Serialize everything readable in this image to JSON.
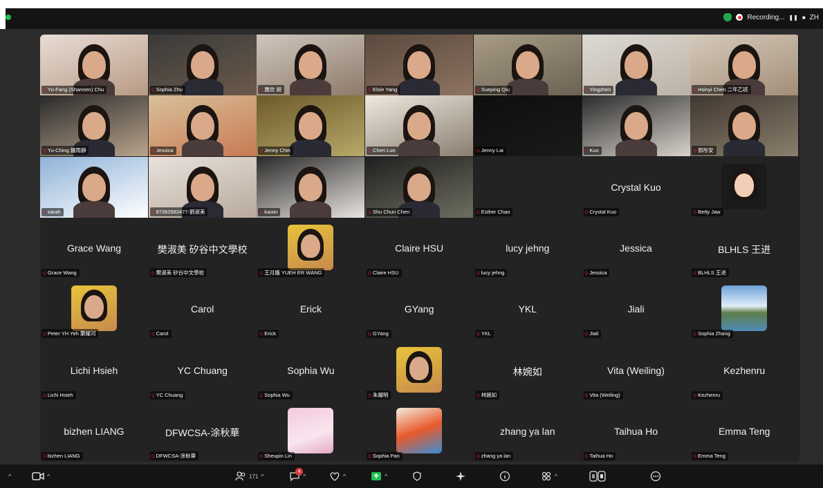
{
  "recording": {
    "label": "Recording...",
    "pause": "❚❚",
    "stop": "■",
    "lang": "ZH"
  },
  "participants": [
    {
      "name": "Yu-Fang (Shannen) Chu",
      "video": true
    },
    {
      "name": "Sophia Zhu",
      "video": true
    },
    {
      "name": "雅欣 胡",
      "video": true
    },
    {
      "name": "Elsie Yang",
      "video": true
    },
    {
      "name": "Sueping Qiu",
      "video": true
    },
    {
      "name": "Yingzhen",
      "video": true
    },
    {
      "name": "Hsinyi Chen 二年乙班",
      "video": true
    },
    {
      "name": "Yu-Ching 鍾雨靜",
      "video": true
    },
    {
      "name": "Jessica",
      "video": true
    },
    {
      "name": "Jenny Chin",
      "video": true
    },
    {
      "name": "Cheri Luo",
      "video": true
    },
    {
      "name": "Jenny Lai",
      "video": true
    },
    {
      "name": "Kuo",
      "video": true
    },
    {
      "name": "郭彤安",
      "video": true
    },
    {
      "name": "sarah",
      "video": true
    },
    {
      "name": "8736298347​7-劉淑美",
      "video": true
    },
    {
      "name": "kaixin",
      "video": true
    },
    {
      "name": "Shu Chun Chen",
      "video": true
    },
    {
      "name": "Esther Chao",
      "video": false,
      "display": ""
    },
    {
      "name": "Crystal Kuo",
      "video": false,
      "display": "Crystal Kuo"
    },
    {
      "name": "Betty Jaw",
      "video": false,
      "avatar": "cartoon"
    },
    {
      "name": "Grace Wang",
      "video": false,
      "display": "Grace Wang"
    },
    {
      "name": "樊淑美 矽谷中文學校",
      "video": false,
      "display": "樊淑美 矽谷中文學校"
    },
    {
      "name": "王月娥 YUEH ER WANG",
      "video": false,
      "avatar": "photo"
    },
    {
      "name": "Claire HSU",
      "video": false,
      "display": "Claire HSU"
    },
    {
      "name": "lucy jehng",
      "video": false,
      "display": "lucy jehng"
    },
    {
      "name": "Jessica",
      "video": false,
      "display": "Jessica"
    },
    {
      "name": "BLHLS 王进",
      "video": false,
      "display": "BLHLS 王进"
    },
    {
      "name": "Peter YH Yeh 葉耀河",
      "video": false,
      "avatar": "photo"
    },
    {
      "name": "Carol",
      "video": false,
      "display": "Carol"
    },
    {
      "name": "Erick",
      "video": false,
      "display": "Erick"
    },
    {
      "name": "GYang",
      "video": false,
      "display": "GYang"
    },
    {
      "name": "YKL",
      "video": false,
      "display": "YKL"
    },
    {
      "name": "Jiali",
      "video": false,
      "display": "Jiali"
    },
    {
      "name": "Sophia Zhang",
      "video": false,
      "avatar": "landscape"
    },
    {
      "name": "Lichi Hsieh",
      "video": false,
      "display": "Lichi Hsieh"
    },
    {
      "name": "YC Chuang",
      "video": false,
      "display": "YC Chuang"
    },
    {
      "name": "Sophia Wu",
      "video": false,
      "display": "Sophia Wu"
    },
    {
      "name": "朱耀明",
      "video": false,
      "avatar": "photo"
    },
    {
      "name": "林婉如",
      "video": false,
      "display": "林婉如"
    },
    {
      "name": "Vita (Weiling)",
      "video": false,
      "display": "Vita (Weiling)"
    },
    {
      "name": "Kezhenru",
      "video": false,
      "display": "Kezhenru"
    },
    {
      "name": "bizhen LIANG",
      "video": false,
      "display": "bizhen LIANG"
    },
    {
      "name": "DFWCSA-涂秋華",
      "video": false,
      "display": "DFWCSA-涂秋華"
    },
    {
      "name": "Sheupin Lin",
      "video": false,
      "avatar": "blossom"
    },
    {
      "name": "Sophia Pan",
      "video": false,
      "avatar": "crayons"
    },
    {
      "name": "zhang ya lan",
      "video": false,
      "display": "zhang ya lan"
    },
    {
      "name": "Taihua Ho",
      "video": false,
      "display": "Taihua Ho"
    },
    {
      "name": "Emma Teng",
      "video": false,
      "display": "Emma Teng"
    }
  ],
  "toolbar": {
    "participants_count": "171",
    "chat_badge": "4"
  },
  "colors": {
    "mic_muted": "#e22244",
    "recording_dot": "#e33333",
    "accent_green": "#1fbf4f"
  }
}
